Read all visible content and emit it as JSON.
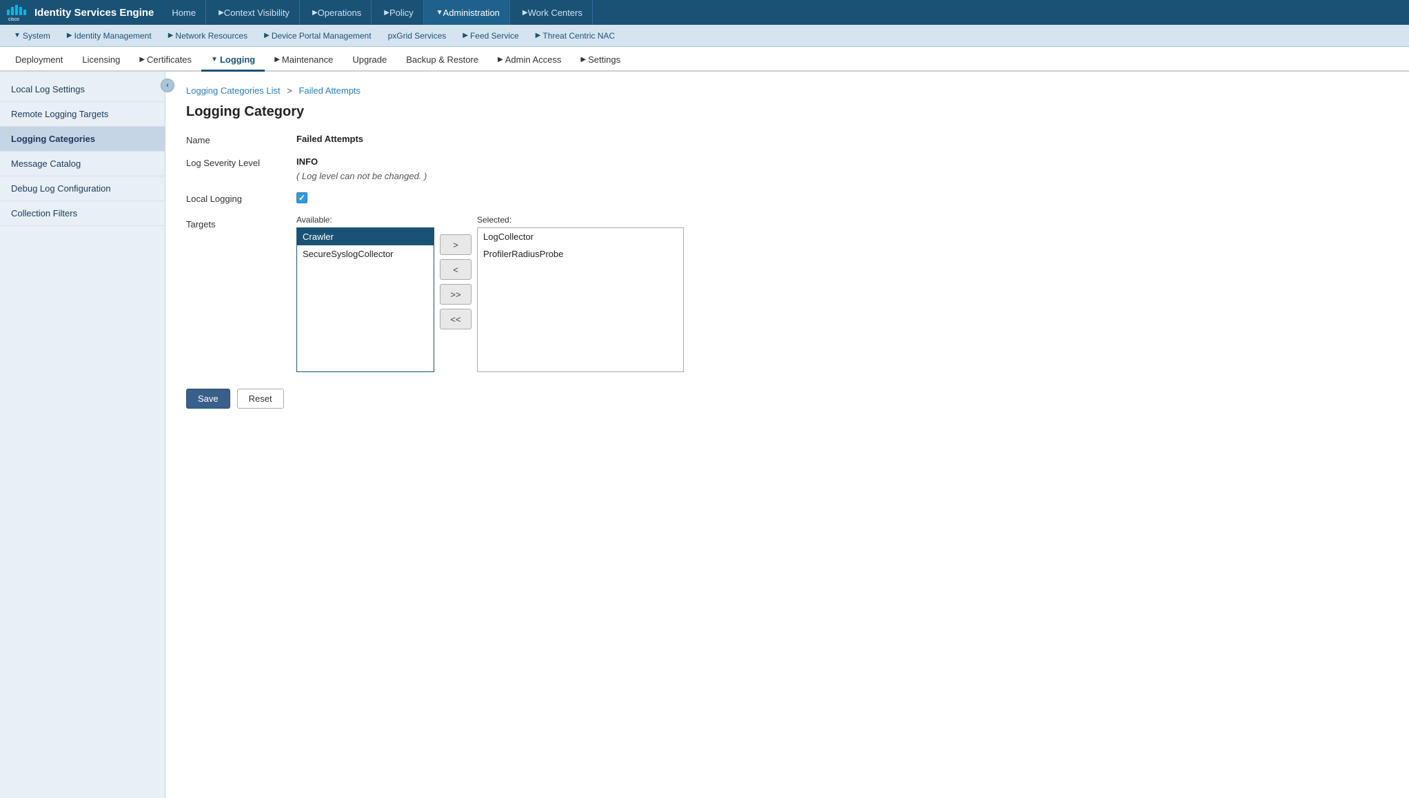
{
  "topNav": {
    "productName": "Identity Services Engine",
    "logoText": "cisco",
    "items": [
      {
        "id": "home",
        "label": "Home",
        "hasArrow": false
      },
      {
        "id": "context-visibility",
        "label": "Context Visibility",
        "hasArrow": true
      },
      {
        "id": "operations",
        "label": "Operations",
        "hasArrow": true
      },
      {
        "id": "policy",
        "label": "Policy",
        "hasArrow": true
      },
      {
        "id": "administration",
        "label": "Administration",
        "hasArrow": true,
        "active": true
      },
      {
        "id": "work-centers",
        "label": "Work Centers",
        "hasArrow": true
      }
    ]
  },
  "secondNav": {
    "items": [
      {
        "id": "system",
        "label": "System",
        "hasArrow": true,
        "active": true
      },
      {
        "id": "identity-management",
        "label": "Identity Management",
        "hasArrow": true
      },
      {
        "id": "network-resources",
        "label": "Network Resources",
        "hasArrow": true
      },
      {
        "id": "device-portal-management",
        "label": "Device Portal Management",
        "hasArrow": true
      },
      {
        "id": "pxgrid-services",
        "label": "pxGrid Services",
        "hasArrow": false
      },
      {
        "id": "feed-service",
        "label": "Feed Service",
        "hasArrow": true
      },
      {
        "id": "threat-centric-nac",
        "label": "Threat Centric NAC",
        "hasArrow": true
      }
    ]
  },
  "tabNav": {
    "items": [
      {
        "id": "deployment",
        "label": "Deployment",
        "hasArrow": false
      },
      {
        "id": "licensing",
        "label": "Licensing",
        "hasArrow": false
      },
      {
        "id": "certificates",
        "label": "Certificates",
        "hasArrow": true
      },
      {
        "id": "logging",
        "label": "Logging",
        "hasArrow": true,
        "active": true
      },
      {
        "id": "maintenance",
        "label": "Maintenance",
        "hasArrow": true
      },
      {
        "id": "upgrade",
        "label": "Upgrade",
        "hasArrow": false
      },
      {
        "id": "backup-restore",
        "label": "Backup & Restore",
        "hasArrow": false
      },
      {
        "id": "admin-access",
        "label": "Admin Access",
        "hasArrow": true
      },
      {
        "id": "settings",
        "label": "Settings",
        "hasArrow": true
      }
    ]
  },
  "sidebar": {
    "items": [
      {
        "id": "local-log-settings",
        "label": "Local Log Settings"
      },
      {
        "id": "remote-logging-targets",
        "label": "Remote Logging Targets"
      },
      {
        "id": "logging-categories",
        "label": "Logging Categories",
        "active": true
      },
      {
        "id": "message-catalog",
        "label": "Message Catalog"
      },
      {
        "id": "debug-log-configuration",
        "label": "Debug Log Configuration"
      },
      {
        "id": "collection-filters",
        "label": "Collection Filters"
      }
    ]
  },
  "breadcrumb": {
    "parent": "Logging Categories List",
    "current": "Failed Attempts"
  },
  "pageTitle": "Logging Category",
  "form": {
    "nameLabel": "Name",
    "nameValue": "Failed Attempts",
    "logSeverityLabel": "Log Severity Level",
    "logSeverityValue": "INFO",
    "logLevelNote": "( Log level can not be changed. )",
    "localLoggingLabel": "Local Logging",
    "targetsLabel": "Targets",
    "availableLabel": "Available:",
    "selectedLabel": "Selected:",
    "availableItems": [
      {
        "id": "crawler",
        "label": "Crawler",
        "selected": true
      },
      {
        "id": "secure-syslog",
        "label": "SecureSyslogCollector",
        "selected": false
      }
    ],
    "selectedItems": [
      {
        "id": "log-collector",
        "label": "LogCollector"
      },
      {
        "id": "profiler-radius",
        "label": "ProfilerRadiusProbe"
      }
    ],
    "transferButtons": [
      {
        "id": "move-right",
        "label": ">"
      },
      {
        "id": "move-left",
        "label": "<"
      },
      {
        "id": "move-all-right",
        "label": ">>"
      },
      {
        "id": "move-all-left",
        "label": "<<"
      }
    ]
  },
  "buttons": {
    "save": "Save",
    "reset": "Reset"
  }
}
